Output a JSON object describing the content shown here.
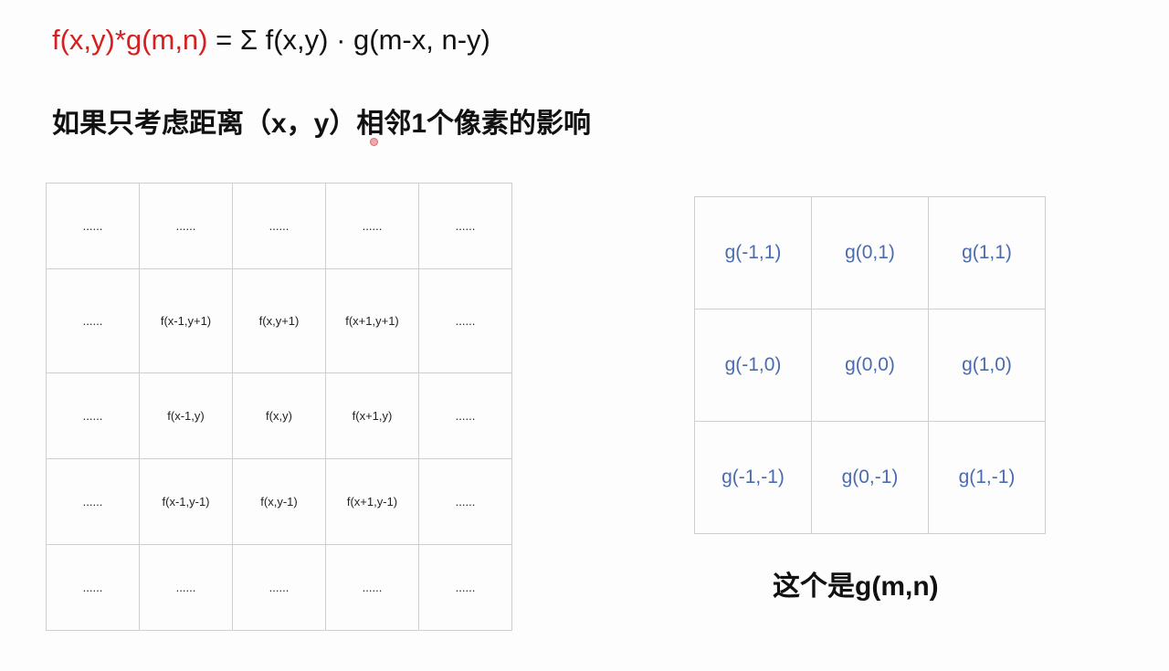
{
  "formula": {
    "lhs": "f(x,y)*g(m,n)",
    "rhs": " = Σ f(x,y) · g(m-x, n-y)",
    "lhs_color": "#d42020"
  },
  "subtitle": "如果只考虑距离（x，y）相邻1个像素的影响",
  "f_grid": [
    [
      "......",
      "......",
      "......",
      "......",
      "......"
    ],
    [
      "......",
      "f(x-1,y+1)",
      "f(x,y+1)",
      "f(x+1,y+1)",
      "......"
    ],
    [
      "......",
      "f(x-1,y)",
      "f(x,y)",
      "f(x+1,y)",
      "......"
    ],
    [
      "......",
      "f(x-1,y-1)",
      "f(x,y-1)",
      "f(x+1,y-1)",
      "......"
    ],
    [
      "......",
      "......",
      "......",
      "......",
      "......"
    ]
  ],
  "g_grid": [
    [
      "g(-1,1)",
      "g(0,1)",
      "g(1,1)"
    ],
    [
      "g(-1,0)",
      "g(0,0)",
      "g(1,0)"
    ],
    [
      "g(-1,-1)",
      "g(0,-1)",
      "g(1,-1)"
    ]
  ],
  "g_text_color": "#4a6cae",
  "caption": "这个是g(m,n)"
}
